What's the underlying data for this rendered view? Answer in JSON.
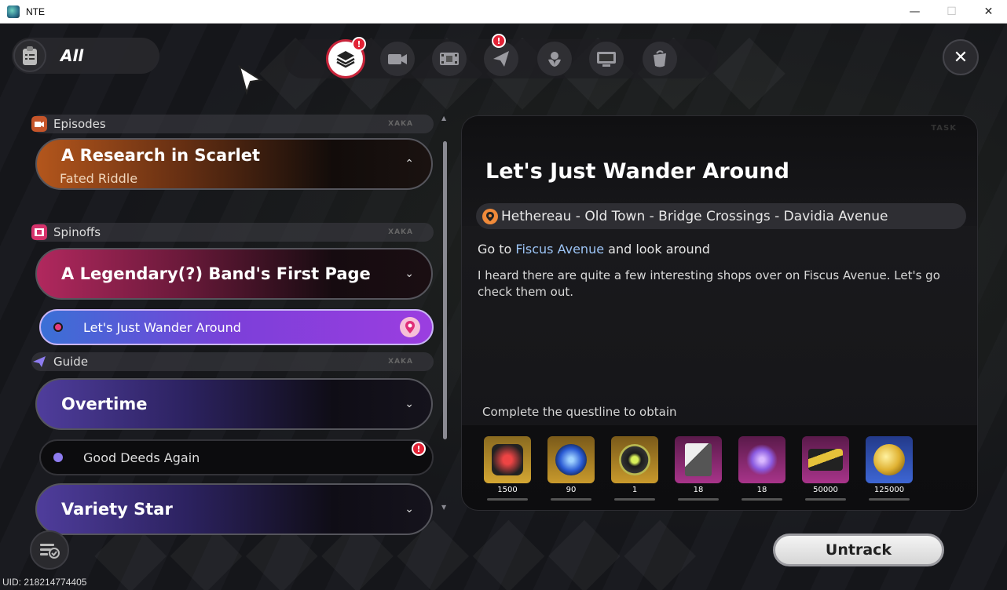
{
  "window": {
    "title": "NTE",
    "minimize": "—",
    "maximize": "☐",
    "close": "✕"
  },
  "topbar": {
    "filter_label": "All",
    "close_symbol": "✕",
    "tabs": [
      {
        "icon": "stack-layers-icon",
        "active": true,
        "badge": "!"
      },
      {
        "icon": "camera-icon",
        "active": false,
        "badge": ""
      },
      {
        "icon": "film-icon",
        "active": false,
        "badge": ""
      },
      {
        "icon": "paper-plane-icon",
        "active": false,
        "badge": "!"
      },
      {
        "icon": "flower-icon",
        "active": false,
        "badge": ""
      },
      {
        "icon": "screen-icon",
        "active": false,
        "badge": ""
      },
      {
        "icon": "cup-icon",
        "active": false,
        "badge": ""
      }
    ]
  },
  "quest_list": {
    "sections": [
      {
        "label": "Episodes",
        "tag": "XAKA"
      },
      {
        "label": "Spinoffs",
        "tag": "XAKA"
      },
      {
        "label": "Guide",
        "tag": "XAKA"
      }
    ],
    "cards": [
      {
        "title": "A Research in Scarlet",
        "subtitle": "Fated Riddle",
        "chevron": "⌃"
      },
      {
        "title": "A Legendary(?) Band's First Page",
        "chevron": "⌄"
      },
      {
        "title": "Overtime",
        "chevron": "⌄"
      },
      {
        "title": "Variety Star",
        "chevron": "⌄"
      }
    ],
    "subquests": [
      {
        "label": "Let's Just Wander Around",
        "tracked": true
      },
      {
        "label": "Good Deeds Again",
        "badge": "!"
      }
    ]
  },
  "detail": {
    "tag": "TASK",
    "title": "Let's Just Wander Around",
    "location": "Hethereau - Old Town - Bridge Crossings - Davidia Avenue",
    "objective_pre": "Go to ",
    "objective_highlight": "Fiscus Avenue",
    "objective_post": " and look around",
    "description": "I heard there are quite a few interesting shops over on Fiscus Avenue. Let's go check them out.",
    "rewards_label": "Complete the questline to obtain",
    "rewards": [
      {
        "count": "1500",
        "icon": "hunter-badge-icon"
      },
      {
        "count": "90",
        "icon": "blue-orb-icon"
      },
      {
        "count": "1",
        "icon": "record-disc-icon"
      },
      {
        "count": "18",
        "icon": "card-pack-icon"
      },
      {
        "count": "18",
        "icon": "crystal-cluster-icon"
      },
      {
        "count": "50000",
        "icon": "ticket-icon"
      },
      {
        "count": "125000",
        "icon": "gold-coin-icon"
      }
    ]
  },
  "bottom": {
    "untrack_label": "Untrack",
    "uid": "UID: 218214774405"
  }
}
